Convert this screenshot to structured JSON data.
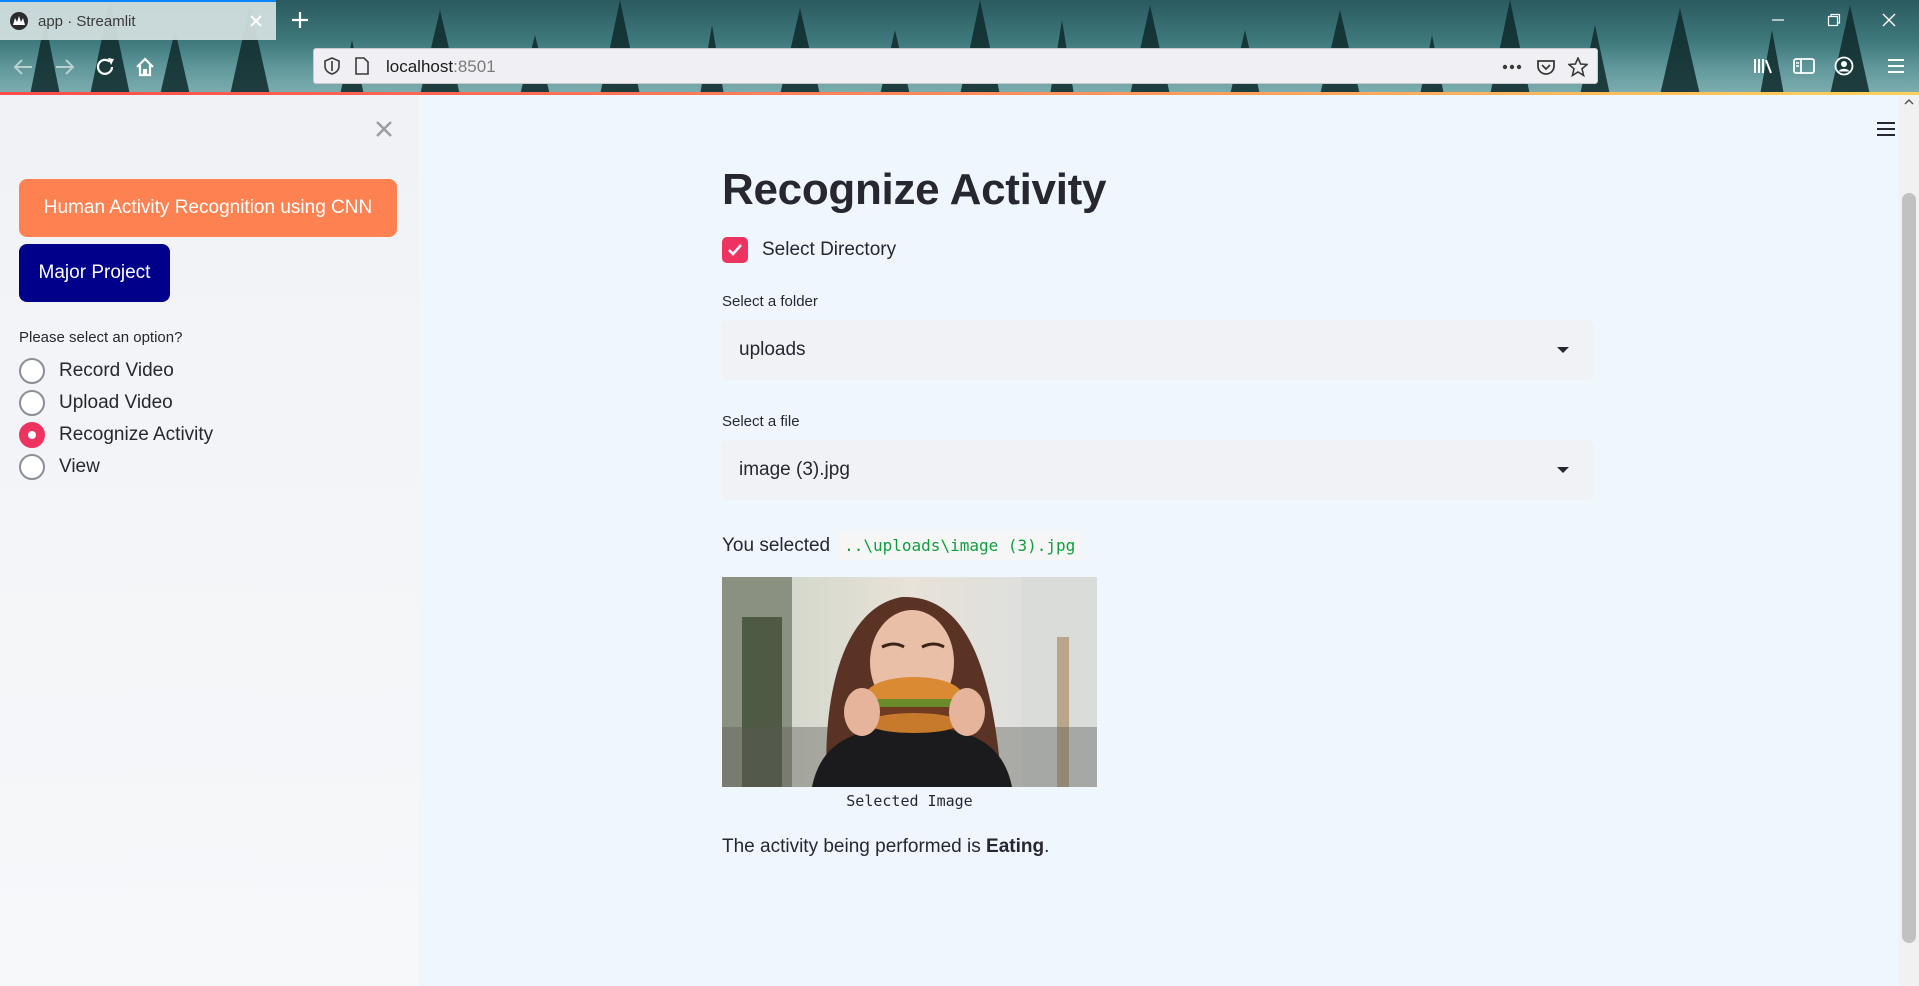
{
  "browser": {
    "tab_title": "app · Streamlit",
    "url_host": "localhost",
    "url_port": ":8501"
  },
  "sidebar": {
    "title_button": "Human Activity Recognition using CNN",
    "project_button": "Major Project",
    "radio_label": "Please select an option?",
    "options": [
      {
        "label": "Record Video",
        "selected": false
      },
      {
        "label": "Upload Video",
        "selected": false
      },
      {
        "label": "Recognize Activity",
        "selected": true
      },
      {
        "label": "View",
        "selected": false
      }
    ]
  },
  "main": {
    "title": "Recognize Activity",
    "checkbox_label": "Select Directory",
    "checkbox_checked": true,
    "folder_label": "Select a folder",
    "folder_value": "uploads",
    "file_label": "Select a file",
    "file_value": "image (3).jpg",
    "you_selected_text": "You selected",
    "selected_path": "..\\uploads\\image (3).jpg",
    "image_caption": "Selected Image",
    "result_prefix": "The activity being performed is",
    "result_activity": "Eating",
    "result_suffix": "."
  },
  "colors": {
    "accent": "#ee3360",
    "title_button_bg": "#fe8251",
    "project_button_bg": "#00008b",
    "code_text": "#0e9f3c"
  }
}
